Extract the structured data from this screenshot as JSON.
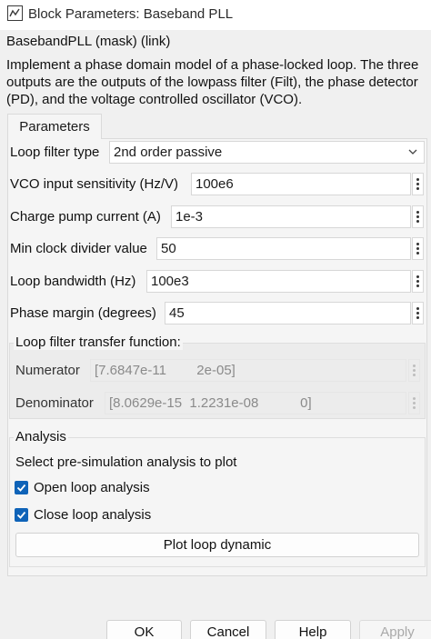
{
  "window": {
    "title": "Block Parameters: Baseband PLL",
    "icon": "simulink-block-icon"
  },
  "header": {
    "mask_title": "BasebandPLL (mask) (link)",
    "description": "Implement a phase domain model of a phase-locked loop.  The three outputs are the outputs of the lowpass filter (Filt), the phase detector (PD), and the voltage controlled oscillator (VCO)."
  },
  "tabs": [
    {
      "label": "Parameters",
      "selected": true
    }
  ],
  "params": {
    "loop_filter_type": {
      "label": "Loop filter type",
      "value": "2nd order passive"
    },
    "vco_sensitivity": {
      "label": "VCO input sensitivity (Hz/V)",
      "value": "100e6"
    },
    "charge_pump_current": {
      "label": "Charge pump current (A)",
      "value": "1e-3"
    },
    "min_clock_divider": {
      "label": "Min clock divider value",
      "value": "50"
    },
    "loop_bandwidth": {
      "label": "Loop bandwidth (Hz)",
      "value": "100e3"
    },
    "phase_margin": {
      "label": "Phase margin (degrees)",
      "value": "45"
    }
  },
  "transfer_function": {
    "title": "Loop filter transfer function:",
    "numerator_label": "Numerator",
    "numerator_value": "[7.6847e-11        2e-05]",
    "denominator_label": "Denominator",
    "denominator_value": "[8.0629e-15  1.2231e-08           0]"
  },
  "analysis": {
    "title": "Analysis",
    "prompt": "Select pre-simulation analysis to plot",
    "open_loop": {
      "label": "Open loop analysis",
      "checked": true
    },
    "close_loop": {
      "label": "Close loop analysis",
      "checked": true
    },
    "plot_button": "Plot loop dynamic"
  },
  "footer": {
    "ok": "OK",
    "cancel": "Cancel",
    "help": "Help",
    "apply": "Apply"
  },
  "colors": {
    "accent": "#0f63b8",
    "dialog_background": "#f0f0f0",
    "panel_background": "#f5f5f5"
  }
}
